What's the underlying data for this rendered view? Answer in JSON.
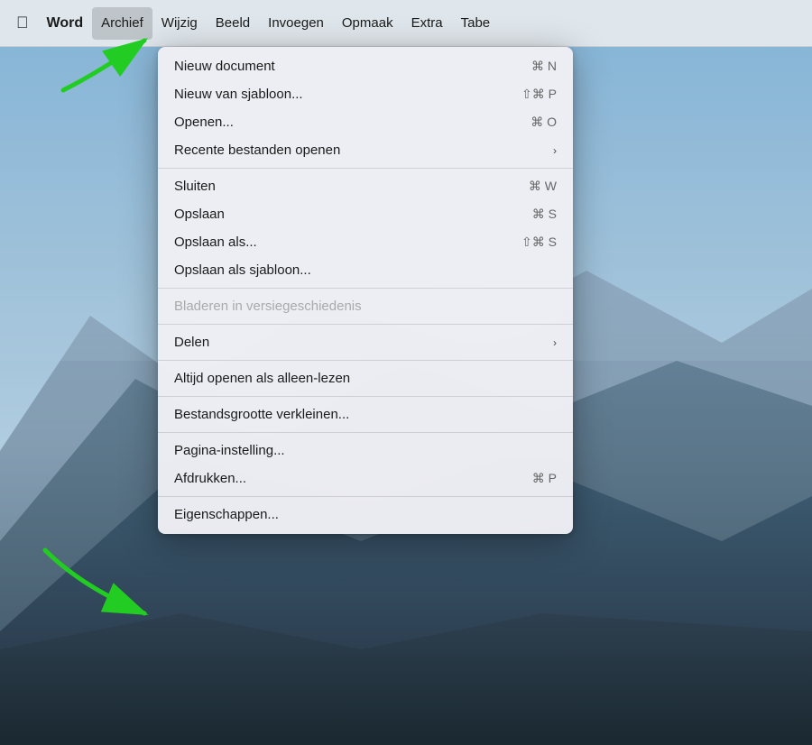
{
  "desktop": {
    "background_description": "macOS Big Sur/Monterey mountain wallpaper"
  },
  "menubar": {
    "apple_label": "",
    "items": [
      {
        "id": "apple",
        "label": ""
      },
      {
        "id": "word",
        "label": "Word",
        "active": false
      },
      {
        "id": "archief",
        "label": "Archief",
        "active": true
      },
      {
        "id": "wijzig",
        "label": "Wijzig"
      },
      {
        "id": "beeld",
        "label": "Beeld"
      },
      {
        "id": "invoegen",
        "label": "Invoegen"
      },
      {
        "id": "opmaak",
        "label": "Opmaak"
      },
      {
        "id": "extra",
        "label": "Extra"
      },
      {
        "id": "tabe",
        "label": "Tabe"
      }
    ]
  },
  "dropdown": {
    "items": [
      {
        "id": "nieuw-document",
        "label": "Nieuw document",
        "shortcut": "⌘ N",
        "separator_after": false,
        "disabled": false,
        "has_submenu": false
      },
      {
        "id": "nieuw-van-sjabloon",
        "label": "Nieuw van sjabloon...",
        "shortcut": "⇧⌘ P",
        "separator_after": false,
        "disabled": false,
        "has_submenu": false
      },
      {
        "id": "openen",
        "label": "Openen...",
        "shortcut": "⌘ O",
        "separator_after": false,
        "disabled": false,
        "has_submenu": false
      },
      {
        "id": "recente-bestanden",
        "label": "Recente bestanden openen",
        "shortcut": "",
        "separator_after": true,
        "disabled": false,
        "has_submenu": true
      },
      {
        "id": "sluiten",
        "label": "Sluiten",
        "shortcut": "⌘ W",
        "separator_after": false,
        "disabled": false,
        "has_submenu": false
      },
      {
        "id": "opslaan",
        "label": "Opslaan",
        "shortcut": "⌘ S",
        "separator_after": false,
        "disabled": false,
        "has_submenu": false
      },
      {
        "id": "opslaan-als",
        "label": "Opslaan als...",
        "shortcut": "⇧⌘ S",
        "separator_after": false,
        "disabled": false,
        "has_submenu": false
      },
      {
        "id": "opslaan-als-sjabloon",
        "label": "Opslaan als sjabloon...",
        "shortcut": "",
        "separator_after": true,
        "disabled": false,
        "has_submenu": false
      },
      {
        "id": "bladeren",
        "label": "Bladeren in versiegeschiedenis",
        "shortcut": "",
        "separator_after": true,
        "disabled": true,
        "has_submenu": false
      },
      {
        "id": "delen",
        "label": "Delen",
        "shortcut": "",
        "separator_after": true,
        "disabled": false,
        "has_submenu": true
      },
      {
        "id": "altijd-openen",
        "label": "Altijd openen als alleen-lezen",
        "shortcut": "",
        "separator_after": true,
        "disabled": false,
        "has_submenu": false
      },
      {
        "id": "bestandsgrootte",
        "label": "Bestandsgrootte verkleinen...",
        "shortcut": "",
        "separator_after": true,
        "disabled": false,
        "has_submenu": false
      },
      {
        "id": "pagina-instelling",
        "label": "Pagina-instelling...",
        "shortcut": "",
        "separator_after": false,
        "disabled": false,
        "has_submenu": false
      },
      {
        "id": "afdrukken",
        "label": "Afdrukken...",
        "shortcut": "⌘ P",
        "separator_after": false,
        "disabled": false,
        "has_submenu": false
      },
      {
        "id": "eigenschappen",
        "label": "Eigenschappen...",
        "shortcut": "",
        "separator_after": false,
        "disabled": false,
        "has_submenu": false
      }
    ]
  },
  "arrows": {
    "top": {
      "description": "Green arrow pointing to Archief menu"
    },
    "bottom": {
      "description": "Green arrow pointing to Pagina-instelling menu item"
    }
  }
}
